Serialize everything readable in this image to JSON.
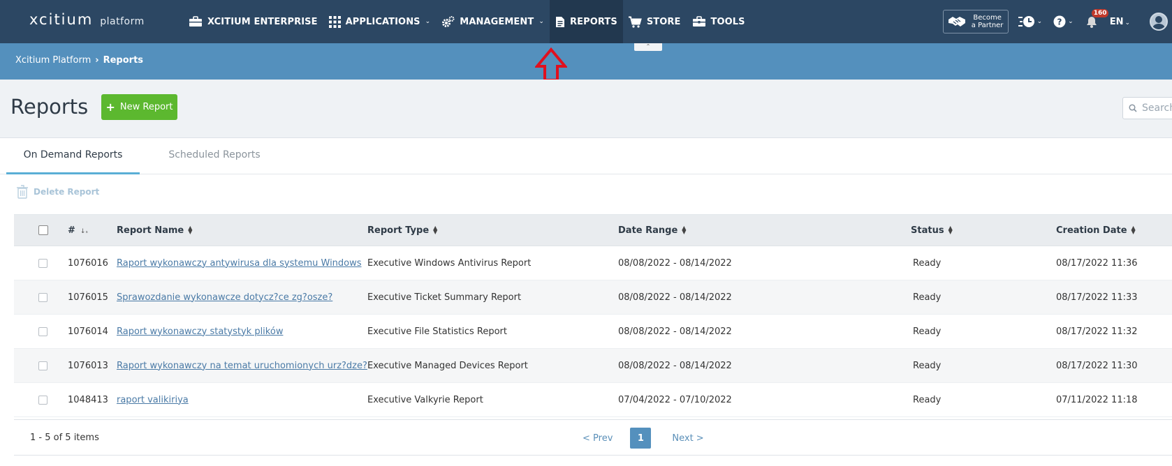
{
  "topnav": {
    "logo_brand": "xcitium",
    "logo_sub": "platform",
    "items": [
      {
        "label": "XCITIUM ENTERPRISE",
        "icon": "briefcase-icon"
      },
      {
        "label": "APPLICATIONS",
        "icon": "grid-icon"
      },
      {
        "label": "MANAGEMENT",
        "icon": "gears-icon"
      },
      {
        "label": "REPORTS",
        "icon": "document-icon"
      },
      {
        "label": "STORE",
        "icon": "cart-icon"
      },
      {
        "label": "TOOLS",
        "icon": "toolbox-icon"
      }
    ],
    "partner_label": "Become a Partner",
    "notification_count": "160",
    "language": "EN"
  },
  "breadcrumb": {
    "root": "Xcitium Platform",
    "current": "Reports"
  },
  "page": {
    "title": "Reports",
    "new_button": "New Report",
    "search_placeholder": "Search"
  },
  "tabs": {
    "on_demand": "On Demand Reports",
    "scheduled": "Scheduled Reports"
  },
  "toolbar": {
    "delete": "Delete Report"
  },
  "table": {
    "columns": {
      "num": "#",
      "name": "Report Name",
      "type": "Report Type",
      "date": "Date Range",
      "status": "Status",
      "created": "Creation Date"
    },
    "rows": [
      {
        "id": "1076016",
        "name": "Raport wykonawczy antywirusa dla systemu Windows",
        "type": "Executive Windows Antivirus Report",
        "date_range": "08/08/2022 - 08/14/2022",
        "status": "Ready",
        "created": "08/17/2022 11:36"
      },
      {
        "id": "1076015",
        "name": "Sprawozdanie wykonawcze dotycz?ce zg?osze?",
        "type": "Executive Ticket Summary Report",
        "date_range": "08/08/2022 - 08/14/2022",
        "status": "Ready",
        "created": "08/17/2022 11:33"
      },
      {
        "id": "1076014",
        "name": "Raport wykonawczy statystyk plików",
        "type": "Executive File Statistics Report",
        "date_range": "08/08/2022 - 08/14/2022",
        "status": "Ready",
        "created": "08/17/2022 11:32"
      },
      {
        "id": "1076013",
        "name": "Raport wykonawczy na temat uruchomionych urz?dze?",
        "type": "Executive Managed Devices Report",
        "date_range": "08/08/2022 - 08/14/2022",
        "status": "Ready",
        "created": "08/17/2022 11:30"
      },
      {
        "id": "1048413",
        "name": "raport valikiriya",
        "type": "Executive Valkyrie Report",
        "date_range": "07/04/2022 - 07/10/2022",
        "status": "Ready",
        "created": "07/11/2022 11:18"
      }
    ]
  },
  "footer": {
    "count": "1 - 5 of 5 items",
    "prev": "< Prev",
    "page": "1",
    "next": "Next >"
  },
  "colors": {
    "topnav": "#2c4763",
    "crumbbar": "#5490bd",
    "new_button": "#5cb82f",
    "link": "#4a7aa6",
    "annotation_arrow": "#e0101e"
  }
}
